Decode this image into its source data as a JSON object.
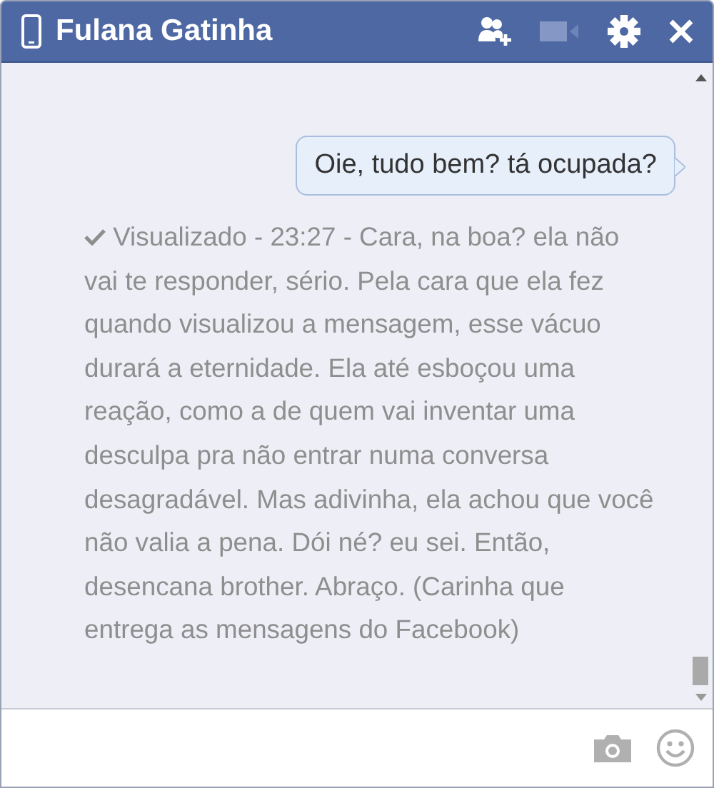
{
  "window": {
    "title": "Fulana Gatinha"
  },
  "messages": [
    {
      "kind": "sent",
      "text": "Oie, tudo bem? tá ocupada?"
    },
    {
      "kind": "seen",
      "text": "Visualizado - 23:27 - Cara, na boa? ela não vai te responder, sério. Pela cara que ela fez quando visualizou a mensagem, esse vácuo durará a eternidade. Ela até esboçou uma reação, como a de quem vai inventar uma desculpa pra não entrar numa conversa desagradável. Mas adivinha, ela achou que você não valia a pena. Dói né? eu sei. Então, desencana brother. Abraço. (Carinha que entrega as mensagens do Facebook)"
    }
  ]
}
